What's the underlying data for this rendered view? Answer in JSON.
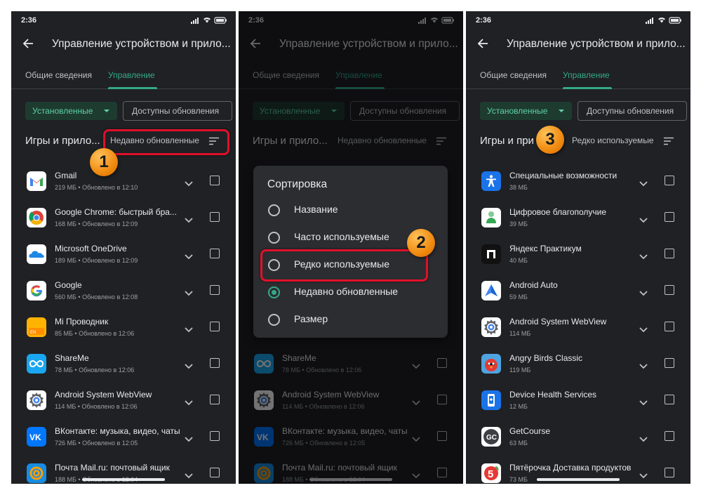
{
  "status": {
    "time": "2:36"
  },
  "appbar": {
    "title": "Управление устройством и прило..."
  },
  "tabs": {
    "overview": "Общие сведения",
    "manage": "Управление"
  },
  "chips": {
    "installed": "Установленные",
    "updates": "Доступны обновления"
  },
  "section": {
    "heading_full": "Игры и прило...",
    "heading_short": "Игры и при"
  },
  "sort": {
    "recent": "Недавно обновленные",
    "rare": "Редко используемые"
  },
  "dialog": {
    "title": "Сортировка",
    "options": [
      "Название",
      "Часто используемые",
      "Редко используемые",
      "Недавно обновленные",
      "Размер"
    ],
    "selected": "Недавно обновленные"
  },
  "badges": [
    "1",
    "2",
    "3"
  ],
  "list_recent": [
    {
      "name": "Gmail",
      "meta": "219 МБ  •  Обновлено в 12:10",
      "icon": "gmail-icon"
    },
    {
      "name": "Google Chrome: быстрый бра...",
      "meta": "168 МБ  •  Обновлено в 12:09",
      "icon": "chrome-icon"
    },
    {
      "name": "Microsoft OneDrive",
      "meta": "189 МБ  •  Обновлено в 12:09",
      "icon": "onedrive-icon"
    },
    {
      "name": "Google",
      "meta": "560 МБ  •  Обновлено в 12:08",
      "icon": "google-icon"
    },
    {
      "name": "Mi Проводник",
      "meta": "85 МБ  •  Обновлено в 12:06",
      "icon": "file-manager-icon"
    },
    {
      "name": "ShareMe",
      "meta": "78 МБ  •  Обновлено в 12:06",
      "icon": "shareme-icon"
    },
    {
      "name": "Android System WebView",
      "meta": "114 МБ  •  Обновлено в 12:06",
      "icon": "webview-icon"
    },
    {
      "name": "ВКонтакте: музыка, видео, чаты",
      "meta": "726 МБ  •  Обновлено в 12:05",
      "icon": "vk-icon"
    },
    {
      "name": "Почта Mail.ru: почтовый ящик",
      "meta": "188 МБ  •  Обновлено в 12:04",
      "icon": "mailru-icon"
    }
  ],
  "list_rare": [
    {
      "name": "Специальные возможности",
      "meta": "38 МБ",
      "icon": "accessibility-icon"
    },
    {
      "name": "Цифровое благополучие",
      "meta": "39 МБ",
      "icon": "wellbeing-icon"
    },
    {
      "name": "Яндекс Практикум",
      "meta": "40 МБ",
      "icon": "yandex-practicum-icon"
    },
    {
      "name": "Android Auto",
      "meta": "59 МБ",
      "icon": "android-auto-icon"
    },
    {
      "name": "Android System WebView",
      "meta": "114 МБ",
      "icon": "webview-icon"
    },
    {
      "name": "Angry Birds Classic",
      "meta": "119 МБ",
      "icon": "angry-birds-icon"
    },
    {
      "name": "Device Health Services",
      "meta": "12 МБ",
      "icon": "device-health-icon"
    },
    {
      "name": "GetCourse",
      "meta": "63 МБ",
      "icon": "getcourse-icon"
    },
    {
      "name": "Пятёрочка Доставка продуктов",
      "meta": "73 МБ",
      "icon": "pyaterochka-icon"
    }
  ],
  "colors": {
    "accent": "#34a98a",
    "background": "#202124",
    "highlight": "#e1102a",
    "badge": "#f08a10"
  }
}
